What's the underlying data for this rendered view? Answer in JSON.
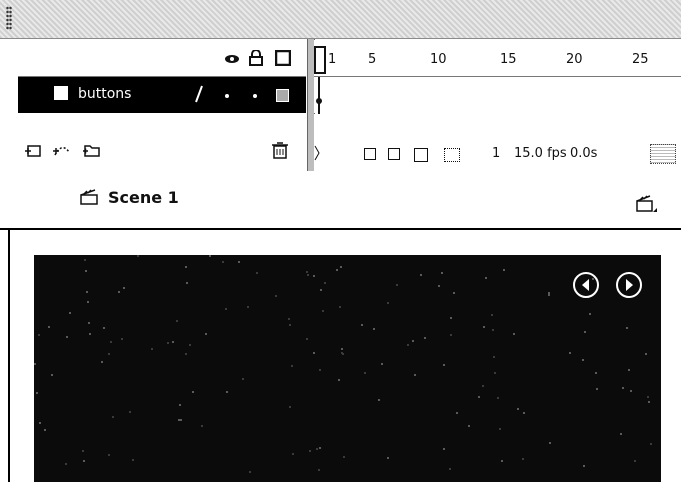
{
  "timeline": {
    "layers": [
      {
        "name": "buttons"
      }
    ],
    "frame_numbers": [
      "1",
      "5",
      "10",
      "15",
      "20",
      "25"
    ],
    "status": {
      "current_frame": "1",
      "frame_rate": "15.0 fps",
      "elapsed": "0.0s"
    }
  },
  "scene": {
    "label": "Scene 1"
  },
  "colors": {
    "stage_background": "#0b0b0b",
    "layer_selected": "#000000",
    "nav_buttons": "#ffffff"
  },
  "icons": {
    "header": [
      "eye-icon",
      "lock-icon",
      "outline-icon"
    ],
    "footer": [
      "insert-layer-icon",
      "add-motion-guide-icon",
      "insert-folder-icon",
      "trash-icon"
    ],
    "status": [
      "center-frame-icon",
      "onion-skin-icon",
      "onion-outline-icon",
      "edit-multiple-frames-icon",
      "modify-onion-markers-icon"
    ],
    "stage": [
      "previous-button-icon",
      "next-button-icon"
    ]
  }
}
